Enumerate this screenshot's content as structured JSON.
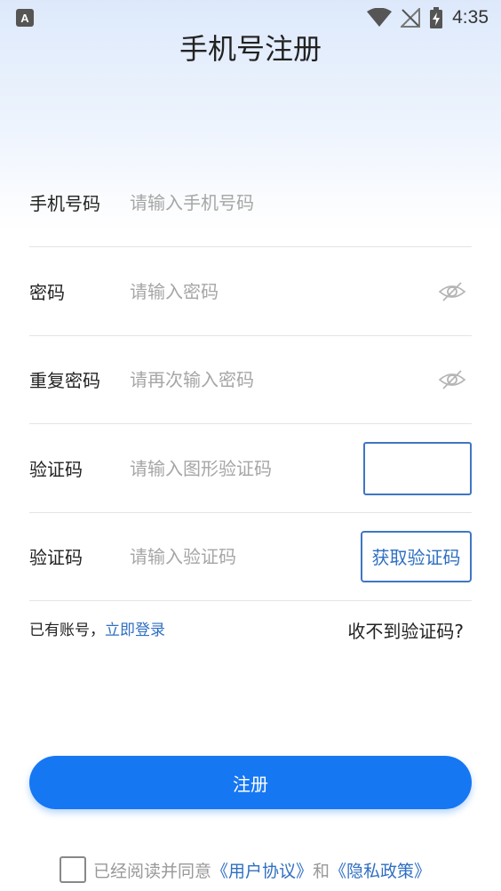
{
  "status_bar": {
    "notification_icon": "A",
    "time": "4:35"
  },
  "title": "手机号注册",
  "form": {
    "phone": {
      "label": "手机号码",
      "placeholder": "请输入手机号码"
    },
    "password": {
      "label": "密码",
      "placeholder": "请输入密码"
    },
    "repeat_password": {
      "label": "重复密码",
      "placeholder": "请再次输入密码"
    },
    "captcha": {
      "label": "验证码",
      "placeholder": "请输入图形验证码"
    },
    "sms_code": {
      "label": "验证码",
      "placeholder": "请输入验证码",
      "button": "获取验证码"
    }
  },
  "links": {
    "have_account": "已有账号，",
    "login": "立即登录",
    "no_code": "收不到验证码?"
  },
  "register_button": "注册",
  "agreement": {
    "prefix": "已经阅读并同意",
    "user_agreement": "《用户协议》",
    "and": "和",
    "privacy_policy": "《隐私政策》"
  },
  "colors": {
    "accent": "#1677f2",
    "link": "#2f6fc2"
  },
  "icons": {
    "wifi": "wifi-icon",
    "signal": "no-signal-icon",
    "battery": "battery-charging-icon",
    "eye": "eye-off-icon"
  }
}
